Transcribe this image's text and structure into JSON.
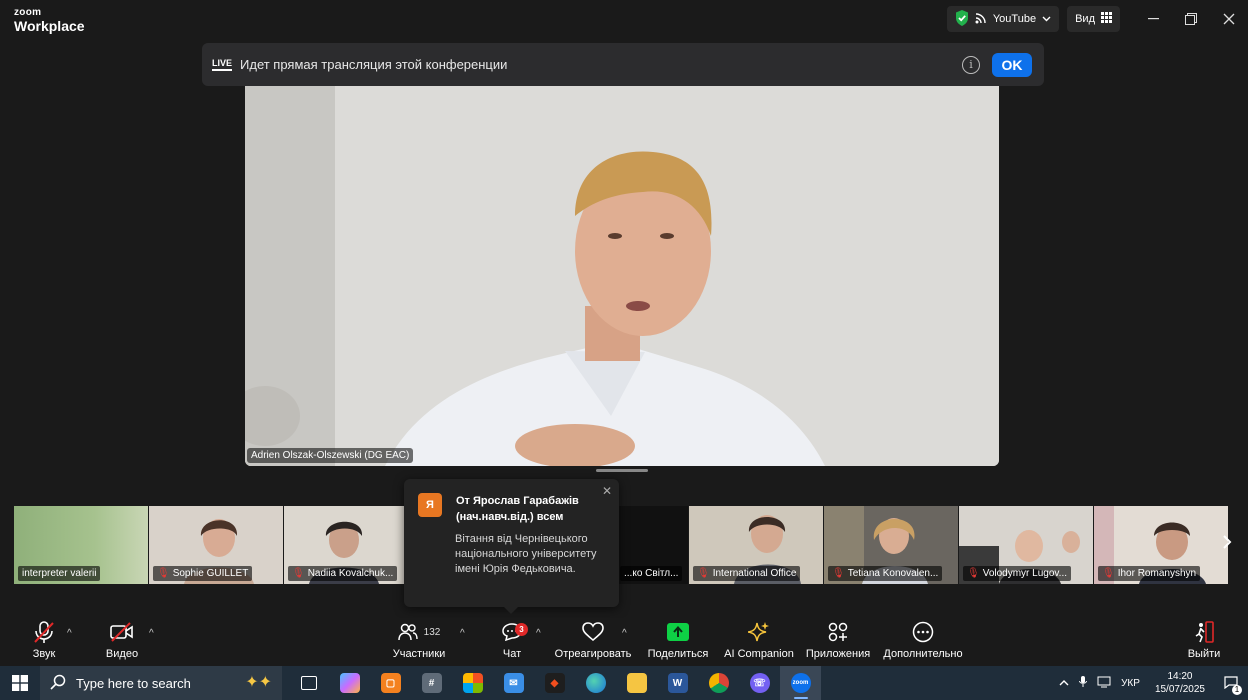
{
  "titlebar": {
    "logo_line1": "zoom",
    "logo_line2": "Workplace",
    "stream_target": "YouTube",
    "view_label": "Вид"
  },
  "live_banner": {
    "badge": "LIVE",
    "text": "Идет прямая трансляция этой конференции",
    "ok_label": "OK"
  },
  "main_video": {
    "speaker_name": "Adrien Olszak-Olszewski (DG EAC)"
  },
  "thumbnails": [
    {
      "name": "interpreter valerii",
      "muted": false
    },
    {
      "name": "Sophie GUILLET",
      "muted": true
    },
    {
      "name": "Nadiia Kovalchuk...",
      "muted": true
    },
    {
      "name": "...ко Світл...",
      "muted": true
    },
    {
      "name": "International Office",
      "muted": true
    },
    {
      "name": "Tetiana Konovalen...",
      "muted": true
    },
    {
      "name": "Volodymyr Lugov...",
      "muted": true
    },
    {
      "name": "Ihor Romanyshyn",
      "muted": true
    }
  ],
  "chat_popup": {
    "avatar_letter": "Я",
    "from": "От Ярослав Гарабажів (нач.навч.від.) всем",
    "message": "Вітання від Чернівецького національного університету імені Юрія Федьковича."
  },
  "toolbar": {
    "audio_label": "Звук",
    "video_label": "Видео",
    "participants_label": "Участники",
    "participants_count": "132",
    "chat_label": "Чат",
    "chat_badge": "3",
    "react_label": "Отреагировать",
    "share_label": "Поделиться",
    "ai_label": "AI Companion",
    "apps_label": "Приложения",
    "more_label": "Дополнительно",
    "leave_label": "Выйти"
  },
  "taskbar": {
    "search_placeholder": "Type here to search",
    "language": "УКР",
    "time": "14:20",
    "date": "15/07/2025",
    "notification_count": "1"
  },
  "colors": {
    "accent": "#0e71eb",
    "share_green": "#0ed145",
    "mute_red": "#e53935",
    "leave_red": "#e02828"
  }
}
